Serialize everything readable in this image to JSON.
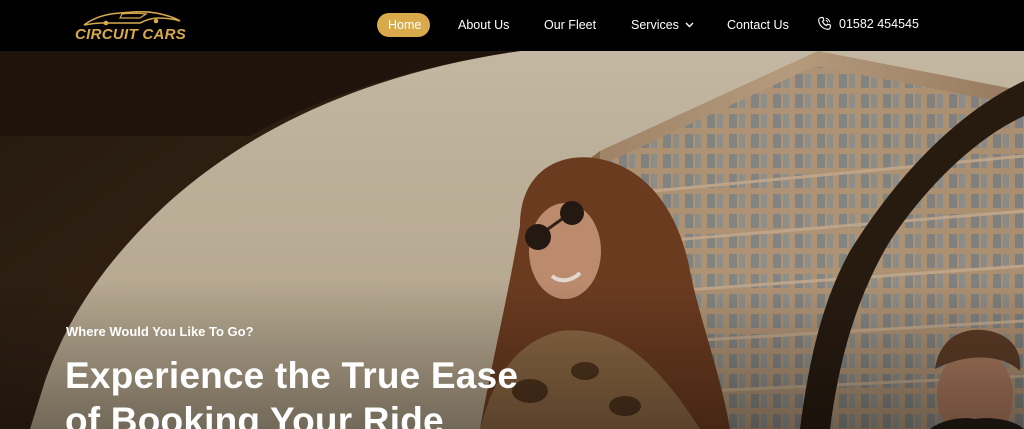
{
  "brand": {
    "logo_text_1": "CIRCUIT",
    "logo_text_2": "CARS",
    "accent_color": "#d8aa4c"
  },
  "nav": {
    "items": [
      {
        "label": "Home",
        "active": true
      },
      {
        "label": "About Us"
      },
      {
        "label": "Our Fleet"
      },
      {
        "label": "Services",
        "has_dropdown": true
      },
      {
        "label": "Contact Us"
      }
    ],
    "phone": {
      "icon": "phone-icon",
      "number": "01582 454545"
    }
  },
  "hero": {
    "tagline": "Where Would You Like To Go?",
    "headline_line_1": "Experience the True Ease",
    "headline_line_2": "of Booking Your Ride"
  }
}
